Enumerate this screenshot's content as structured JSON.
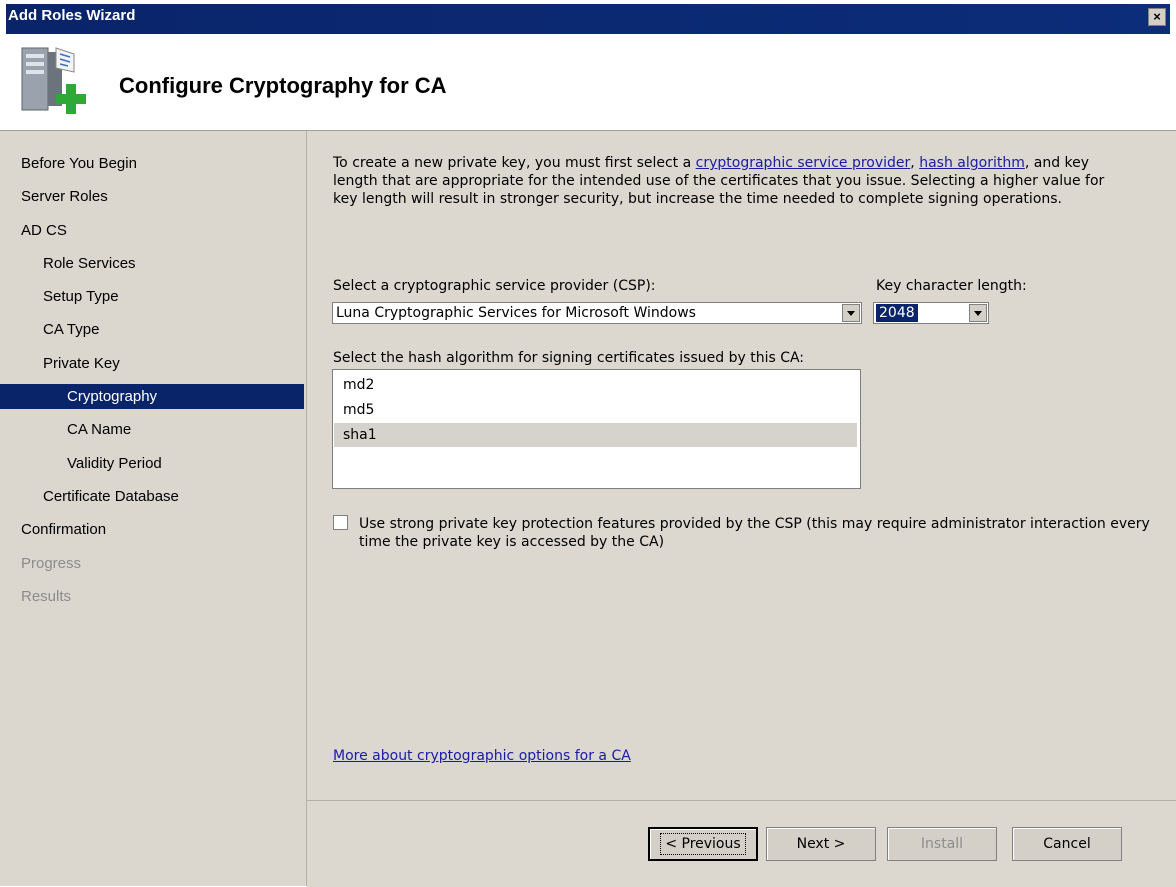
{
  "window": {
    "title": "Add Roles Wizard",
    "close_glyph": "×"
  },
  "header": {
    "page_title": "Configure Cryptography for CA",
    "icon": "server-add-role-icon"
  },
  "sidebar": {
    "items": [
      {
        "label": "Before You Begin",
        "indent": 0,
        "state": "normal"
      },
      {
        "label": "Server Roles",
        "indent": 0,
        "state": "normal"
      },
      {
        "label": "AD CS",
        "indent": 0,
        "state": "normal"
      },
      {
        "label": "Role Services",
        "indent": 1,
        "state": "normal"
      },
      {
        "label": "Setup Type",
        "indent": 1,
        "state": "normal"
      },
      {
        "label": "CA Type",
        "indent": 1,
        "state": "normal"
      },
      {
        "label": "Private Key",
        "indent": 1,
        "state": "normal"
      },
      {
        "label": "Cryptography",
        "indent": 2,
        "state": "selected"
      },
      {
        "label": "CA Name",
        "indent": 2,
        "state": "normal"
      },
      {
        "label": "Validity Period",
        "indent": 2,
        "state": "normal"
      },
      {
        "label": "Certificate Database",
        "indent": 1,
        "state": "normal"
      },
      {
        "label": "Confirmation",
        "indent": 0,
        "state": "normal"
      },
      {
        "label": "Progress",
        "indent": 0,
        "state": "disabled"
      },
      {
        "label": "Results",
        "indent": 0,
        "state": "disabled"
      }
    ]
  },
  "main": {
    "intro_part1": "To create a new private key, you must first select a ",
    "link_csp": "cryptographic service provider",
    "intro_sep": ", ",
    "link_hash": "hash algorithm",
    "intro_part2": ", and key length that are appropriate for the intended use of the certificates that you issue. Selecting a higher value for key length will result in stronger security, but increase the time needed to complete signing operations.",
    "csp_label": "Select a cryptographic service provider (CSP):",
    "csp_value": "Luna Cryptographic Services for Microsoft Windows",
    "key_length_label": "Key character length:",
    "key_length_value": "2048",
    "hash_label": "Select the hash algorithm for signing certificates issued by this CA:",
    "hash_options": [
      "md2",
      "md5",
      "sha1"
    ],
    "hash_selected": "sha1",
    "strong_protection_label": "Use strong private key protection features provided by the CSP (this may require administrator interaction every time the private key is accessed by the CA)",
    "strong_protection_checked": false,
    "more_link": "More about cryptographic options for a CA"
  },
  "footer": {
    "previous": "< Previous",
    "next": "Next >",
    "install": "Install",
    "cancel": "Cancel"
  },
  "colors": {
    "selection": "#0a246a",
    "link": "#1a1aa6",
    "sidebar_bg": "#dbd7cf",
    "panel_bg": "#dcd8d0"
  }
}
